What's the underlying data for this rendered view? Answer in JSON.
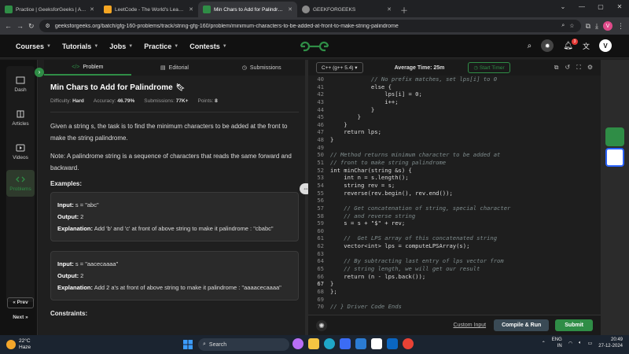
{
  "browser": {
    "tabs": [
      {
        "title": "Practice | GeeksforGeeks | A co",
        "color": "#2f8d46"
      },
      {
        "title": "LeetCode - The World's Leading",
        "color": "#f5a623"
      },
      {
        "title": "Min Chars to Add for Palindrom",
        "color": "#2f8d46"
      },
      {
        "title": "GEEKFORGEEKS",
        "color": "#8a8a8a"
      }
    ],
    "url": "geeksforgeeks.org/batch/gfg-160-problems/track/string-gfg-160/problem/minimum-characters-to-be-added-at-front-to-make-string-palindrome",
    "profile_initial": "V"
  },
  "gfg_nav": {
    "items": [
      "Courses",
      "Tutorials",
      "Jobs",
      "Practice",
      "Contests"
    ],
    "notif_count": "3",
    "user_initial": "V"
  },
  "rail": {
    "items": [
      "Dash",
      "Articles",
      "Videos",
      "Problems"
    ],
    "prev": "Prev",
    "next": "Next"
  },
  "problem_tabs": [
    "Problem",
    "Editorial",
    "Submissions"
  ],
  "problem": {
    "title": "Min Chars to Add for Palindrome",
    "difficulty_label": "Difficulty:",
    "difficulty": "Hard",
    "accuracy_label": "Accuracy:",
    "accuracy": "46.79%",
    "submissions_label": "Submissions:",
    "submissions": "77K+",
    "points_label": "Points:",
    "points": "8",
    "desc1": "Given a string s, the task is to find the minimum characters to be added at the front to make the string palindrome.",
    "desc2": "Note: A palindrome string is a sequence of characters that reads the same forward and backward.",
    "examples_heading": "Examples:",
    "examples": [
      {
        "input": "s = \"abc\"",
        "output": "2",
        "explanation": "Add 'b' and 'c' at front of above string to make it palindrome : \"cbabc\""
      },
      {
        "input": "s = \"aacecaaaa\"",
        "output": "2",
        "explanation": "Add 2 a's at front of above string to make it palindrome : \"aaaacecaaaa\""
      }
    ],
    "input_label": "Input:",
    "output_label": "Output:",
    "explanation_label": "Explanation:",
    "constraints_heading": "Constraints:"
  },
  "editor": {
    "language": "C++ (g++ 5.4)",
    "avg_time": "Average Time: 25m",
    "timer": "Start Timer",
    "lines": [
      {
        "n": "40",
        "t": "            // No prefix matches, set lps[i] to 0",
        "c": true
      },
      {
        "n": "41",
        "t": "            else {"
      },
      {
        "n": "42",
        "t": "                lps[i] = 0;"
      },
      {
        "n": "43",
        "t": "                i++;"
      },
      {
        "n": "44",
        "t": "            }"
      },
      {
        "n": "45",
        "t": "        }"
      },
      {
        "n": "46",
        "t": "    }"
      },
      {
        "n": "47",
        "t": "    return lps;"
      },
      {
        "n": "48",
        "t": "}"
      },
      {
        "n": "49",
        "t": ""
      },
      {
        "n": "50",
        "t": "// Method returns minimum character to be added at",
        "c": true
      },
      {
        "n": "51",
        "t": "// front to make string palindrome",
        "c": true
      },
      {
        "n": "52",
        "t": "int minChar(string &s) {"
      },
      {
        "n": "53",
        "t": "    int n = s.length();"
      },
      {
        "n": "54",
        "t": "    string rev = s;"
      },
      {
        "n": "55",
        "t": "    reverse(rev.begin(), rev.end());"
      },
      {
        "n": "56",
        "t": ""
      },
      {
        "n": "57",
        "t": "    // Get concatenation of string, special character",
        "c": true
      },
      {
        "n": "58",
        "t": "    // and reverse string",
        "c": true
      },
      {
        "n": "59",
        "t": "    s = s + \"$\" + rev;"
      },
      {
        "n": "60",
        "t": ""
      },
      {
        "n": "61",
        "t": "    //  Get LPS array of this concatenated string",
        "c": true
      },
      {
        "n": "62",
        "t": "    vector<int> lps = computeLPSArray(s);"
      },
      {
        "n": "63",
        "t": ""
      },
      {
        "n": "64",
        "t": "    // By subtracting last entry of lps vector from",
        "c": true
      },
      {
        "n": "65",
        "t": "    // string length, we will get our result",
        "c": true
      },
      {
        "n": "66",
        "t": "    return (n - lps.back());"
      },
      {
        "n": "67",
        "t": "}"
      },
      {
        "n": "68",
        "t": "};"
      },
      {
        "n": "69",
        "t": ""
      },
      {
        "n": "70",
        "t": "// } Driver Code Ends",
        "c": true
      }
    ],
    "custom_input": "Custom Input",
    "compile_run": "Compile & Run",
    "submit": "Submit"
  },
  "taskbar": {
    "temp": "22°C",
    "weather": "Haze",
    "search": "Search",
    "lang1": "ENG",
    "lang2": "IN",
    "time": "20:49",
    "date": "27-12-2024",
    "weather_badge": "1"
  },
  "colors": {
    "accent": "#2f8d46"
  }
}
